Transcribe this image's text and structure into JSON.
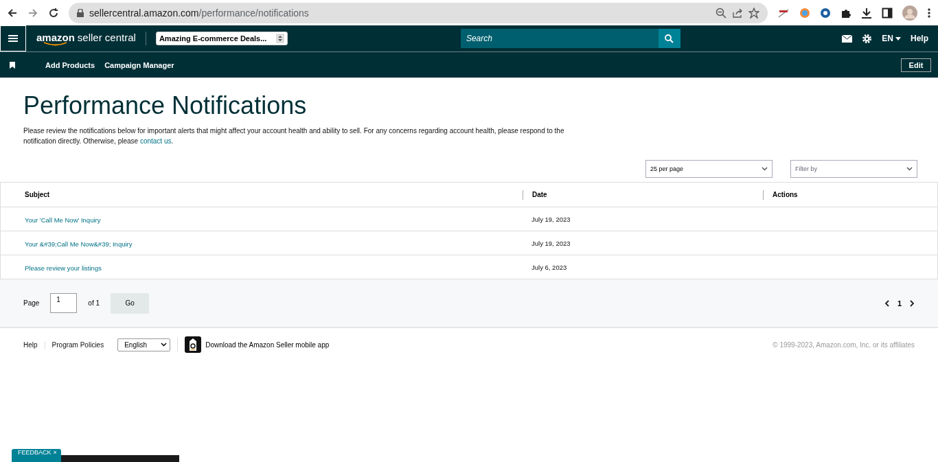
{
  "browser": {
    "url_host": "sellercentral.amazon.com",
    "url_path": "/performance/notifications"
  },
  "header": {
    "logo_brand": "amazon",
    "logo_product": "seller central",
    "account": "Amazing E-commerce Deals...",
    "search": {
      "placeholder": "Search"
    },
    "language": "EN",
    "help": "Help"
  },
  "subnav": {
    "links": [
      "Add Products",
      "Campaign Manager"
    ],
    "edit": "Edit"
  },
  "page": {
    "title": "Performance Notifications",
    "description": "Please review the notifications below for important alerts that might affect your account health and ability to sell. For any concerns regarding account health, please respond to the notification directly. Otherwise, please ",
    "contact_link": "contact us",
    "description_end": "."
  },
  "controls": {
    "per_page": "25 per page",
    "filter": {
      "placeholder": "Filter by"
    }
  },
  "table": {
    "columns": [
      "Subject",
      "Date",
      "Actions"
    ],
    "rows": [
      {
        "subject": "Your 'Call Me Now' Inquiry",
        "date": "July 19, 2023"
      },
      {
        "subject": "Your &#39;Call Me Now&#39; Inquiry",
        "date": "July 19, 2023"
      },
      {
        "subject": "Please review your listings",
        "date": "July 6, 2023"
      }
    ]
  },
  "pagination": {
    "page_label": "Page",
    "page_value": "1",
    "of_label": "of 1",
    "go": "Go",
    "current": "1"
  },
  "footer": {
    "links": [
      "Help",
      "Program Policies"
    ],
    "language": "English",
    "app_text": "Download the Amazon Seller mobile app",
    "copyright": "© 1999-2023, Amazon.com, Inc. or its affiliates"
  },
  "feedback": {
    "label": "FEEDBACK",
    "close": "×"
  }
}
